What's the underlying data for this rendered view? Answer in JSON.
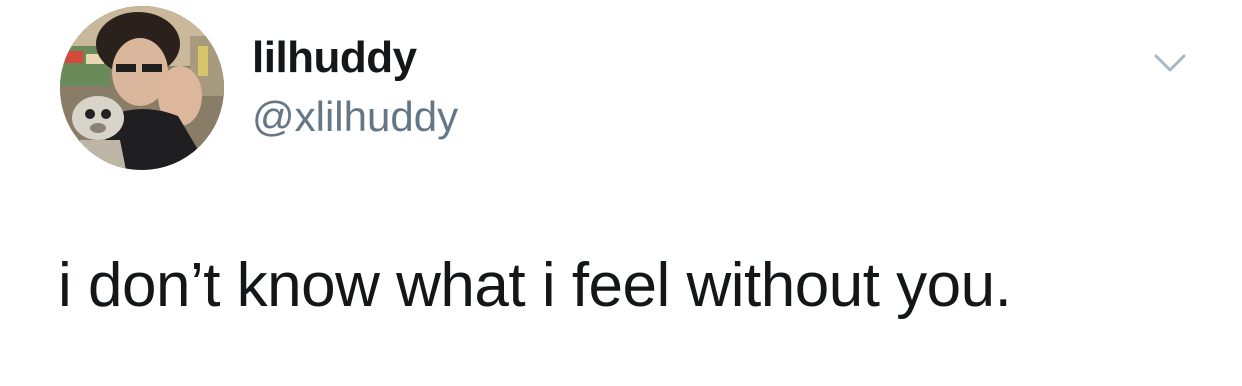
{
  "tweet": {
    "author": {
      "display_name": "lilhuddy",
      "handle": "@xlilhuddy",
      "avatar_icon": "profile-photo"
    },
    "menu_icon": "chevron-down-icon",
    "text": "i don’t know what i feel without you."
  },
  "colors": {
    "background": "#ffffff",
    "name": "#14171a",
    "handle": "#657786",
    "caret": "#aab8c2"
  }
}
